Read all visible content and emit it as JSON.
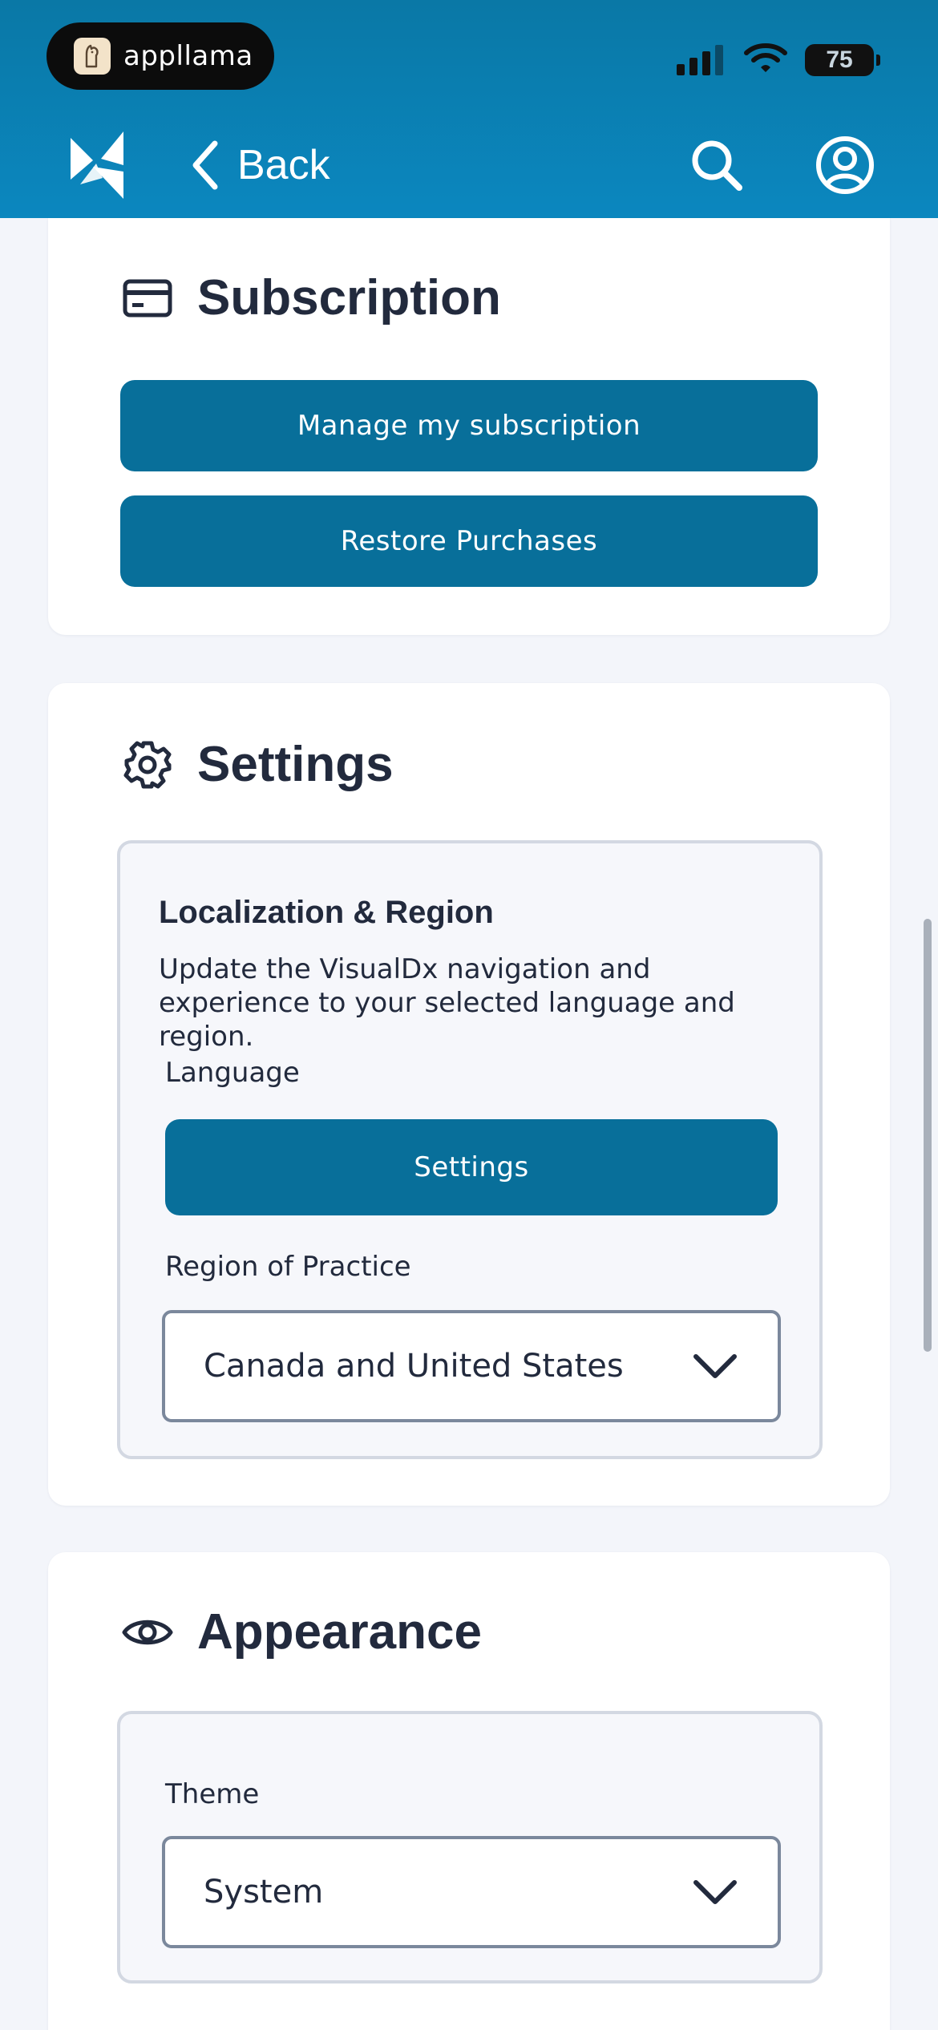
{
  "status_bar": {
    "app_name": "appllama",
    "battery": "75"
  },
  "nav": {
    "back_label": "Back"
  },
  "subscription": {
    "title": "Subscription",
    "manage_label": "Manage my subscription",
    "restore_label": "Restore Purchases"
  },
  "settings": {
    "title": "Settings",
    "localization": {
      "title": "Localization & Region",
      "description": "Update the VisualDx navigation and experience to your selected language and region.",
      "language_label": "Language",
      "language_button": "Settings",
      "region_label": "Region of Practice",
      "region_value": "Canada and United States"
    }
  },
  "appearance": {
    "title": "Appearance",
    "theme_label": "Theme",
    "theme_value": "System"
  },
  "colors": {
    "header": "#0b87bf",
    "primary_button": "#086f9a",
    "text": "#222a3d",
    "background": "#f3f5fa"
  },
  "icons": {
    "subscription": "credit-card-icon",
    "settings": "gear-icon",
    "appearance": "eye-icon",
    "search": "search-icon",
    "account": "user-circle-icon",
    "back": "chevron-left-icon",
    "dropdown": "chevron-down-icon"
  }
}
